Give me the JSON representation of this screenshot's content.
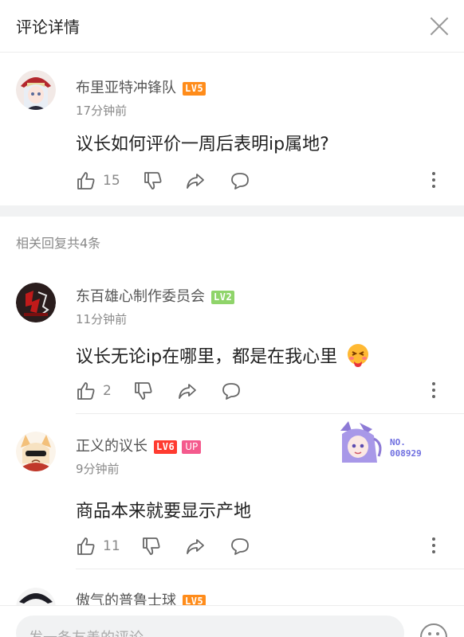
{
  "header": {
    "title": "评论详情"
  },
  "main_comment": {
    "username": "布里亚特冲锋队",
    "level": "LV5",
    "time": "17分钟前",
    "text": "议长如何评价一周后表明ip属地?",
    "likes": "15"
  },
  "replies_header": "相关回复共4条",
  "replies": [
    {
      "username": "东百雄心制作委员会",
      "level": "LV2",
      "time": "11分钟前",
      "text": "议长无论ip在哪里，都是在我心里",
      "likes": "2"
    },
    {
      "username": "正义的议长",
      "level": "LV6",
      "up_badge": "UP",
      "time": "9分钟前",
      "text": "商品本来就要显示产地",
      "likes": "11",
      "fan_badge": {
        "label": "NO.",
        "number": "008929"
      }
    },
    {
      "username": "傲气的普鲁士球",
      "level": "LV5"
    }
  ],
  "comment_input": {
    "placeholder": "发一条友善的评论"
  },
  "icons": [
    "close-icon",
    "thumbs-up-icon",
    "thumbs-down-icon",
    "share-icon",
    "reply-bubble-icon",
    "more-vertical-icon",
    "emoji-icon"
  ]
}
